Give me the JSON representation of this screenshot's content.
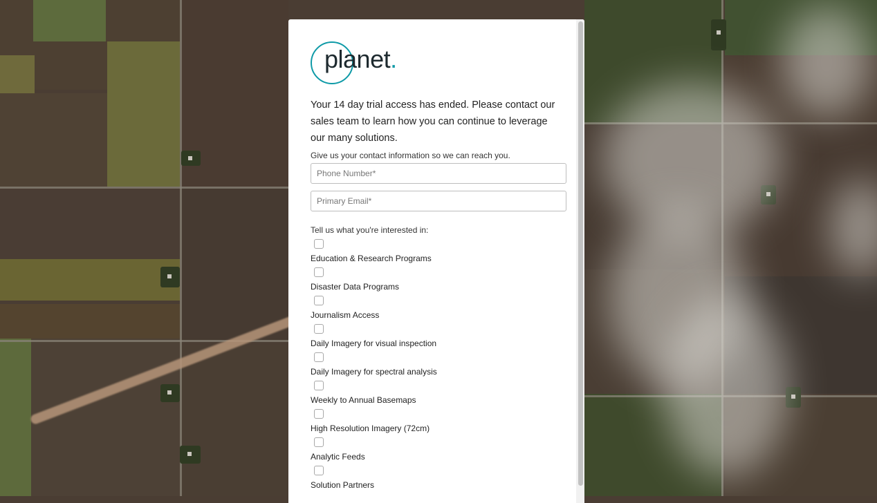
{
  "brand": {
    "name": "planet",
    "dot": ".",
    "accent": "#0e9aa7"
  },
  "message": "Your 14 day trial access has ended. Please contact our sales team to learn how you can continue to leverage our many solutions.",
  "contact": {
    "prompt": "Give us your contact information so we can reach you.",
    "phone_placeholder": "Phone Number*",
    "email_placeholder": "Primary Email*"
  },
  "interests": {
    "prompt": "Tell us what you're interested in:",
    "options": [
      "Education & Research Programs",
      "Disaster Data Programs",
      "Journalism Access",
      "Daily Imagery for visual inspection",
      "Daily Imagery for spectral analysis",
      "Weekly to Annual Basemaps",
      "High Resolution Imagery (72cm)",
      "Analytic Feeds",
      "Solution Partners"
    ]
  }
}
